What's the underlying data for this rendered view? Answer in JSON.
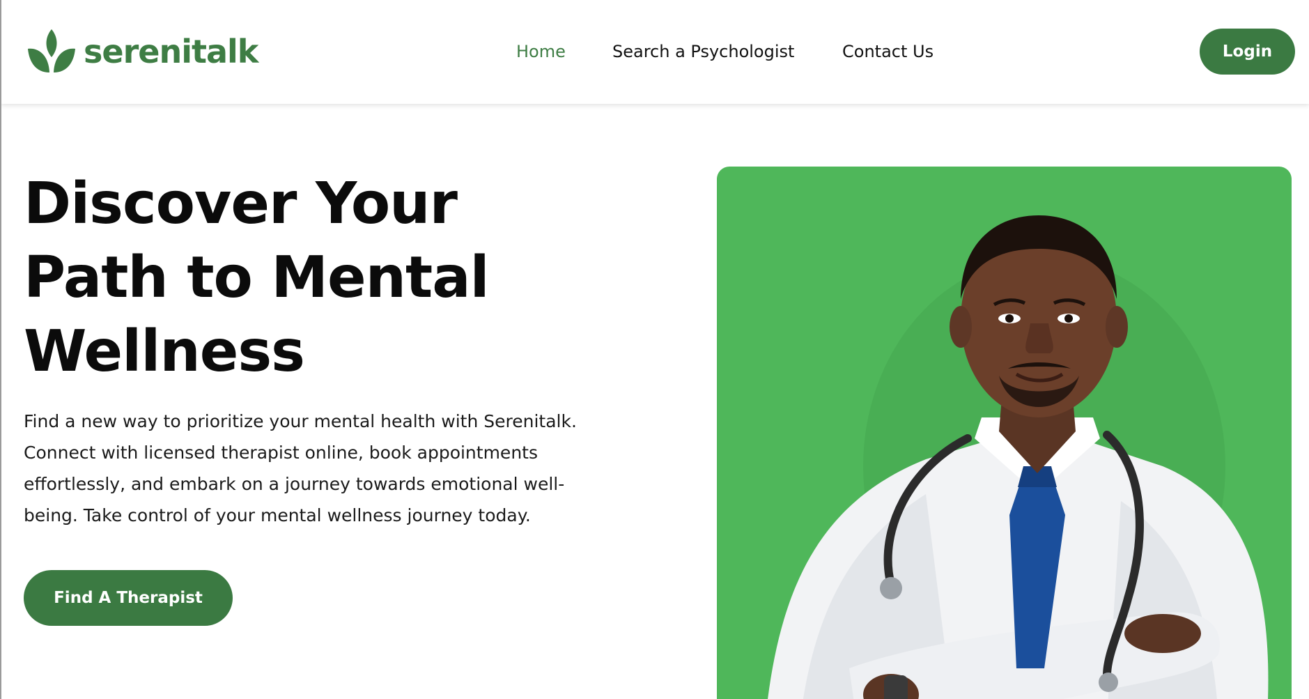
{
  "brand": {
    "name": "serenitalk",
    "color": "#3e7d44",
    "icon": "leaf-icon"
  },
  "nav": {
    "items": [
      {
        "label": "Home",
        "active": true
      },
      {
        "label": "Search a Psychologist",
        "active": false
      },
      {
        "label": "Contact Us",
        "active": false
      }
    ],
    "active_color": "#3e7d44"
  },
  "header": {
    "login_label": "Login"
  },
  "hero": {
    "title_lines": [
      "Discover Your",
      "Path to Mental",
      "Wellness"
    ],
    "description_lines": [
      "Find a new way to prioritize your mental health with Serenitalk.",
      "Connect with licensed therapist online, book appointments",
      "effortlessly, and embark on a journey towards emotional well-",
      "being. Take control of your mental wellness journey today."
    ],
    "cta_label": "Find A Therapist"
  },
  "image": {
    "subject": "doctor-photo",
    "background_color": "#4fb75a"
  },
  "colors": {
    "primary_button": "#3b7a42",
    "text": "#111111"
  }
}
